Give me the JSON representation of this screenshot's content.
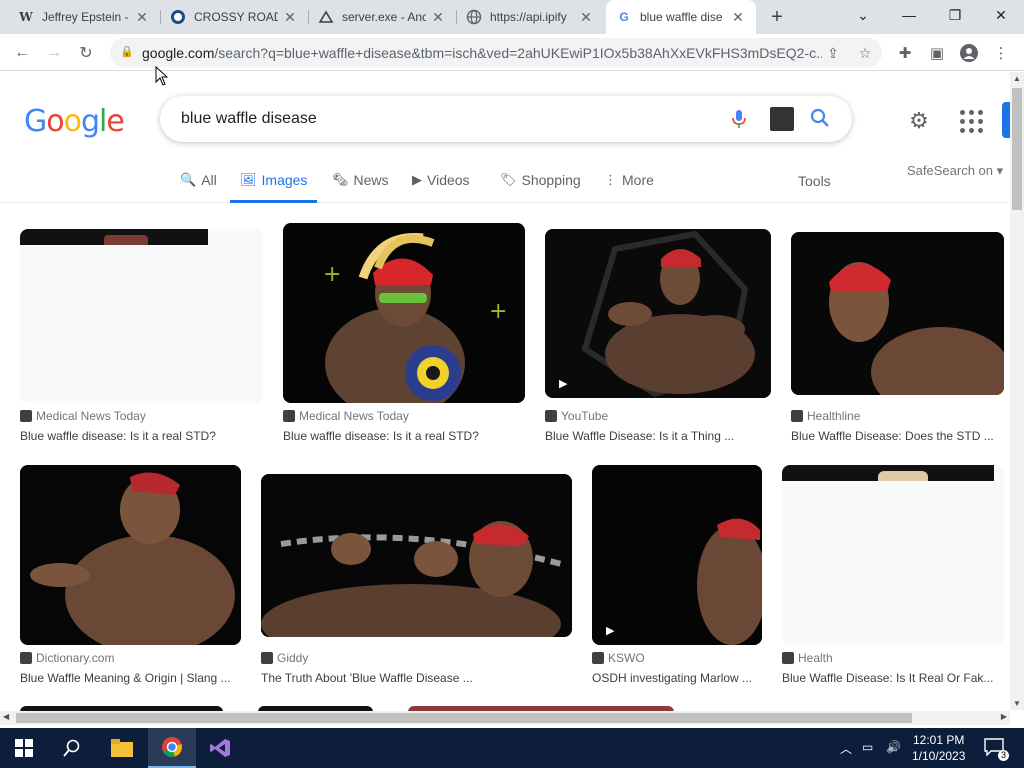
{
  "browser": {
    "tabs": [
      {
        "title": "Jeffrey Epstein -",
        "icon": "wikipedia-icon",
        "active": false
      },
      {
        "title": "CROSSY ROAD",
        "icon": "site-icon",
        "active": false
      },
      {
        "title": "server.exe - Anc",
        "icon": "site-icon",
        "active": false
      },
      {
        "title": "https://api.ipify",
        "icon": "globe-icon",
        "active": false
      },
      {
        "title": "blue waffle dise",
        "icon": "google-icon",
        "active": true
      }
    ],
    "url_host": "google.com",
    "url_path": "/search?q=blue+waffle+disease&tbm=isch&ved=2ahUKEwiP1IOx5b38AhXxEVkFHS3mDsEQ2-c..."
  },
  "google": {
    "query": "blue waffle disease",
    "tabs": [
      {
        "label": "All",
        "icon": "🔍"
      },
      {
        "label": "Images",
        "icon": "🖼"
      },
      {
        "label": "News",
        "icon": "🗞"
      },
      {
        "label": "Videos",
        "icon": "▶"
      },
      {
        "label": "Shopping",
        "icon": "🏷"
      },
      {
        "label": "More",
        "icon": "⋮"
      }
    ],
    "tools_label": "Tools",
    "safesearch_label": "SafeSearch on ▾",
    "results": [
      {
        "source": "Medical News Today",
        "title": "Blue waffle disease: Is it a real STD?"
      },
      {
        "source": "Medical News Today",
        "title": "Blue waffle disease: Is it a real STD?"
      },
      {
        "source": "YouTube",
        "title": "Blue Waffle Disease: Is it a Thing ..."
      },
      {
        "source": "Healthline",
        "title": "Blue Waffle Disease: Does the STD ..."
      },
      {
        "source": "Dictionary.com",
        "title": "Blue Waffle Meaning & Origin | Slang ..."
      },
      {
        "source": "Giddy",
        "title": "The Truth About 'Blue Waffle Disease ..."
      },
      {
        "source": "KSWO",
        "title": "OSDH investigating Marlow ..."
      },
      {
        "source": "Health",
        "title": "Blue Waffle Disease: Is It Real Or Fak..."
      }
    ]
  },
  "taskbar": {
    "time": "12:01 PM",
    "date": "1/10/2023",
    "notifications": "3"
  }
}
